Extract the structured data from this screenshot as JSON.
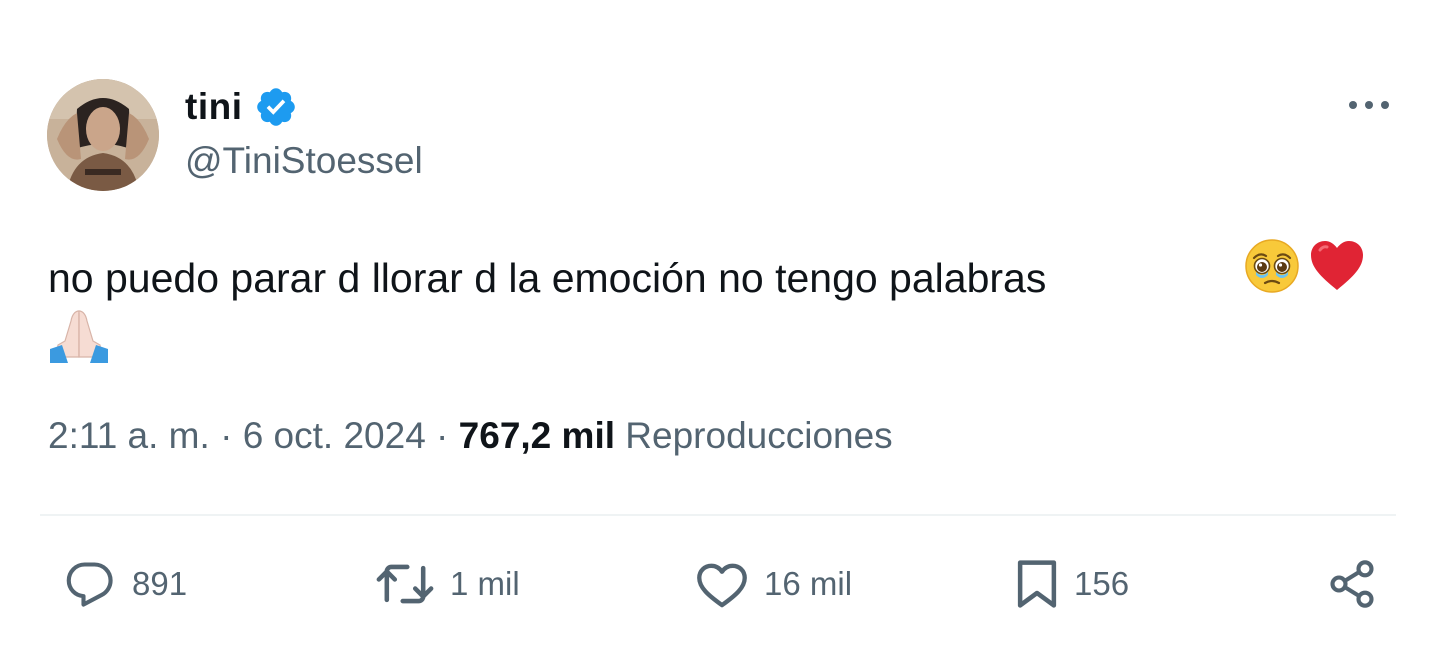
{
  "author": {
    "display_name": "tini",
    "handle": "@TiniStoessel",
    "verified": true
  },
  "tweet": {
    "text": "no puedo parar d llorar d la emoción no tengo palabras",
    "emojis": [
      "pleading-face",
      "red-heart",
      "folded-hands"
    ]
  },
  "meta": {
    "time": "2:11 a. m.",
    "separator": " · ",
    "date": "6 oct. 2024",
    "views_count": "767,2 mil",
    "views_label": "Reproducciones"
  },
  "actions": {
    "replies": "891",
    "reposts": "1 mil",
    "likes": "16 mil",
    "bookmarks": "156"
  },
  "colors": {
    "text": "#0f1419",
    "secondary": "#536471",
    "verified": "#1d9bf0",
    "divider": "#eff3f4"
  }
}
